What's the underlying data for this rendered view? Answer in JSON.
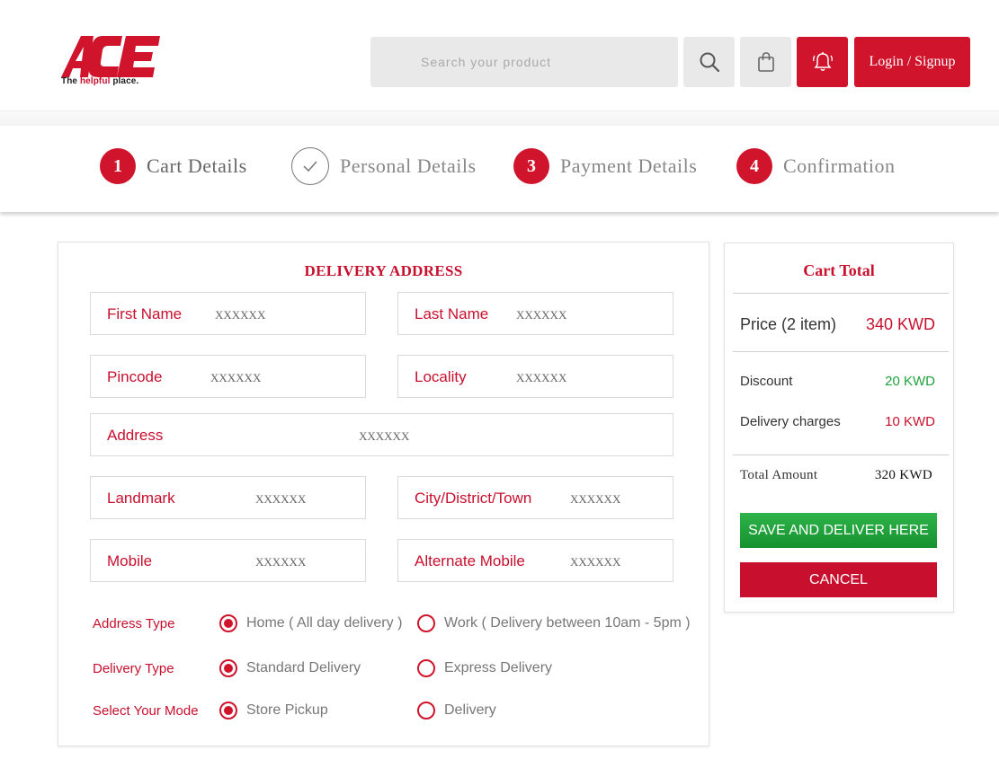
{
  "colors": {
    "brand": "#c8102e",
    "button_red": "#d0142c",
    "green": "#1ea23a"
  },
  "header": {
    "logo_text": "ACE",
    "tagline_pre": "The ",
    "tagline_red": "helpful",
    "tagline_post": " place.",
    "search_placeholder": "Search your product",
    "search_icon": "search-icon",
    "bag_icon": "shopping-bag-icon",
    "bell_icon": "bell-icon",
    "login_label": "Login / Signup"
  },
  "steps": [
    {
      "number": "1",
      "label": "Cart Details"
    },
    {
      "number": "",
      "label": "Personal Details"
    },
    {
      "number": "3",
      "label": "Payment Details"
    },
    {
      "number": "4",
      "label": "Confirmation"
    }
  ],
  "address": {
    "title": "DELIVERY ADDRESS",
    "fields": {
      "first_name": {
        "label": "First Name",
        "value": "XXXXXX"
      },
      "last_name": {
        "label": "Last Name",
        "value": "XXXXXX"
      },
      "pincode": {
        "label": "Pincode",
        "value": "XXXXXX"
      },
      "locality": {
        "label": "Locality",
        "value": "XXXXXX"
      },
      "address": {
        "label": "Address",
        "value": "XXXXXX"
      },
      "landmark": {
        "label": "Landmark",
        "value": "XXXXXX"
      },
      "city": {
        "label": "City/District/Town",
        "value": "XXXXXX"
      },
      "mobile": {
        "label": "Mobile",
        "value": "XXXXXX"
      },
      "alt_mobile": {
        "label": "Alternate Mobile",
        "value": "XXXXXX"
      }
    },
    "address_type": {
      "label": "Address Type",
      "option1": "Home ( All day delivery )",
      "option2": "Work ( Delivery between 10am - 5pm )",
      "selected": "option1"
    },
    "delivery_type": {
      "label": "Delivery Type",
      "option1": "Standard Delivery",
      "option2": "Express Delivery",
      "selected": "option1"
    },
    "mode": {
      "label": "Select Your Mode",
      "option1": "Store Pickup",
      "option2": "Delivery",
      "selected": "option1"
    }
  },
  "cart": {
    "title": "Cart Total",
    "price_label": "Price (2 item)",
    "price_value": "340 KWD",
    "discount_label": "Discount",
    "discount_value": "20 KWD",
    "delivery_label": "Delivery charges",
    "delivery_value": "10 KWD",
    "total_label": "Total Amount",
    "total_value": "320 KWD",
    "save_label": "SAVE AND DELIVER HERE",
    "cancel_label": "CANCEL"
  }
}
